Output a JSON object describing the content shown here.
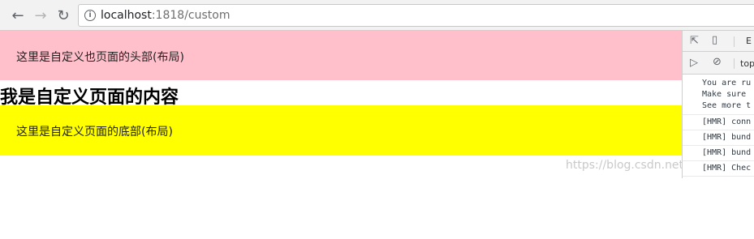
{
  "browser": {
    "url_host": "localhost",
    "url_path": ":1818/custom",
    "back_icon": "arrow-left-icon",
    "forward_icon": "arrow-right-icon",
    "reload_icon": "reload-icon",
    "info_icon": "info-icon",
    "info_glyph": "i"
  },
  "page": {
    "header_text": "这里是自定义也页面的头部(布局)",
    "content_title": "我是自定义页面的内容",
    "footer_text": "这里是自定义页面的底部(布局)",
    "header_color": "#ffc0cb",
    "footer_color": "#ffff00",
    "watermark": "https://blog.csdn.net/m..."
  },
  "devtools": {
    "panel_tab_partial": "E",
    "context_partial": "top",
    "console_lines": [
      "You are ru",
      "Make sure",
      "See more t"
    ],
    "hmr_lines": [
      "[HMR] conn",
      "[HMR] bund",
      "[HMR] bund",
      "[HMR] Chec"
    ]
  }
}
